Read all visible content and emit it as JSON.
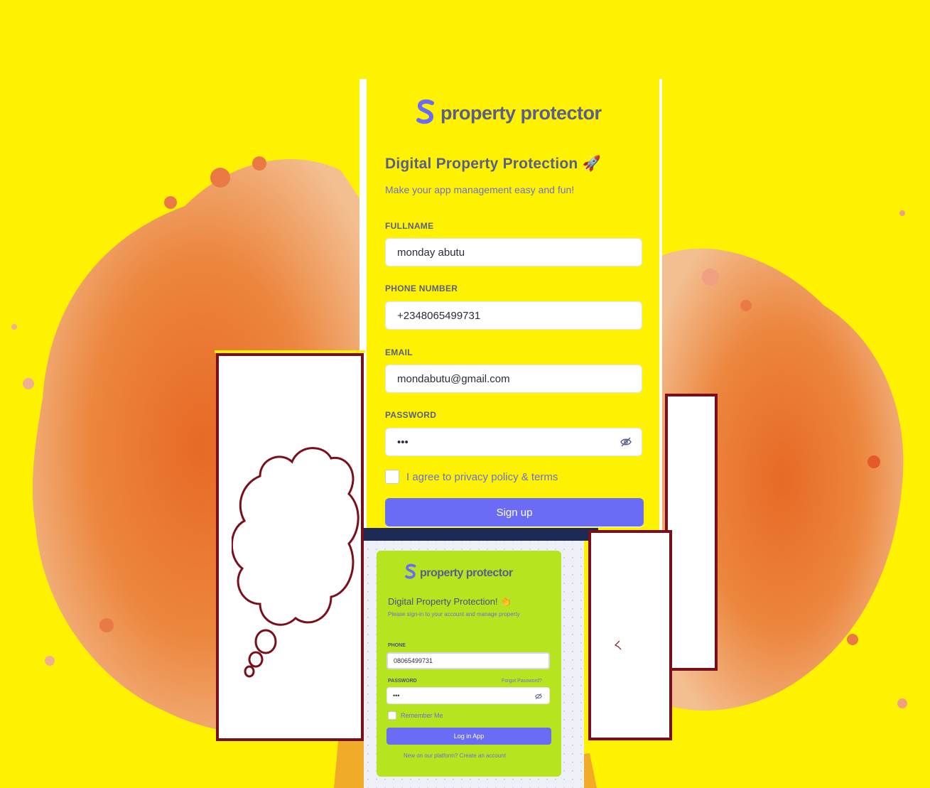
{
  "colors": {
    "background": "#fff200",
    "accent": "#6b6cf6",
    "login_card": "#b6e51f",
    "panel_border": "#7a0f1c",
    "splash": "#e8632e"
  },
  "signup": {
    "logo_icon": "s-logo-icon",
    "brand": "property protector",
    "heading": "Digital Property Protection 🚀",
    "subheading": "Make your app management easy and fun!",
    "fields": [
      {
        "label": "FULLNAME",
        "value": "monday abutu"
      },
      {
        "label": "PHONE NUMBER",
        "value": "+2348065499731"
      },
      {
        "label": "EMAIL",
        "value": "mondabutu@gmail.com"
      },
      {
        "label": "PASSWORD",
        "value": "•••"
      }
    ],
    "password_toggle_icon": "eye-off-icon",
    "agree_text": "I agree to privacy policy & terms",
    "agree_checked": false,
    "submit": "Sign up"
  },
  "login": {
    "logo_icon": "s-logo-icon",
    "brand": "property protector",
    "heading": "Digital Property Protection! 👏",
    "subheading": "Please sign-in to your account and manage property",
    "phone_label": "PHONE",
    "phone_value": "08065499731",
    "password_label": "PASSWORD",
    "forgot": "Forgot Password?",
    "password_value": "•••",
    "remember": "Remember Me",
    "remember_checked": false,
    "submit": "Log in App",
    "new_account": "New on our platform? Create an account"
  }
}
